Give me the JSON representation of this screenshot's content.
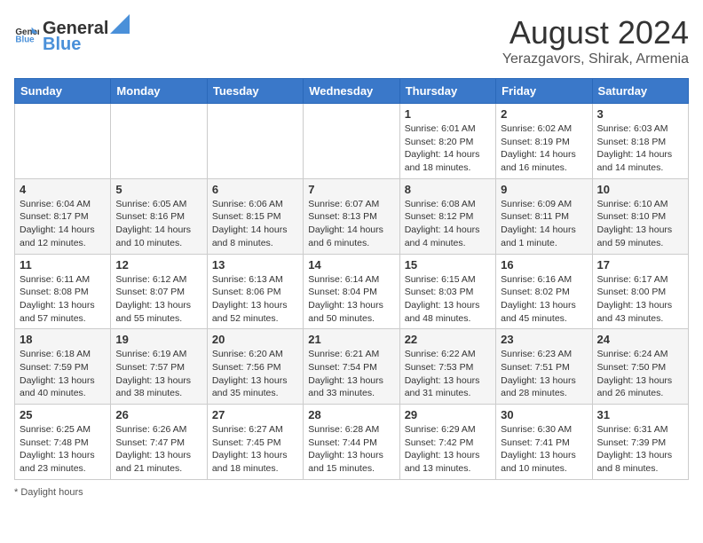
{
  "logo": {
    "general": "General",
    "blue": "Blue"
  },
  "title": "August 2024",
  "subtitle": "Yerazgavors, Shirak, Armenia",
  "days_header": [
    "Sunday",
    "Monday",
    "Tuesday",
    "Wednesday",
    "Thursday",
    "Friday",
    "Saturday"
  ],
  "weeks": [
    [
      {
        "day": "",
        "info": ""
      },
      {
        "day": "",
        "info": ""
      },
      {
        "day": "",
        "info": ""
      },
      {
        "day": "",
        "info": ""
      },
      {
        "day": "1",
        "info": "Sunrise: 6:01 AM\nSunset: 8:20 PM\nDaylight: 14 hours\nand 18 minutes."
      },
      {
        "day": "2",
        "info": "Sunrise: 6:02 AM\nSunset: 8:19 PM\nDaylight: 14 hours\nand 16 minutes."
      },
      {
        "day": "3",
        "info": "Sunrise: 6:03 AM\nSunset: 8:18 PM\nDaylight: 14 hours\nand 14 minutes."
      }
    ],
    [
      {
        "day": "4",
        "info": "Sunrise: 6:04 AM\nSunset: 8:17 PM\nDaylight: 14 hours\nand 12 minutes."
      },
      {
        "day": "5",
        "info": "Sunrise: 6:05 AM\nSunset: 8:16 PM\nDaylight: 14 hours\nand 10 minutes."
      },
      {
        "day": "6",
        "info": "Sunrise: 6:06 AM\nSunset: 8:15 PM\nDaylight: 14 hours\nand 8 minutes."
      },
      {
        "day": "7",
        "info": "Sunrise: 6:07 AM\nSunset: 8:13 PM\nDaylight: 14 hours\nand 6 minutes."
      },
      {
        "day": "8",
        "info": "Sunrise: 6:08 AM\nSunset: 8:12 PM\nDaylight: 14 hours\nand 4 minutes."
      },
      {
        "day": "9",
        "info": "Sunrise: 6:09 AM\nSunset: 8:11 PM\nDaylight: 14 hours\nand 1 minute."
      },
      {
        "day": "10",
        "info": "Sunrise: 6:10 AM\nSunset: 8:10 PM\nDaylight: 13 hours\nand 59 minutes."
      }
    ],
    [
      {
        "day": "11",
        "info": "Sunrise: 6:11 AM\nSunset: 8:08 PM\nDaylight: 13 hours\nand 57 minutes."
      },
      {
        "day": "12",
        "info": "Sunrise: 6:12 AM\nSunset: 8:07 PM\nDaylight: 13 hours\nand 55 minutes."
      },
      {
        "day": "13",
        "info": "Sunrise: 6:13 AM\nSunset: 8:06 PM\nDaylight: 13 hours\nand 52 minutes."
      },
      {
        "day": "14",
        "info": "Sunrise: 6:14 AM\nSunset: 8:04 PM\nDaylight: 13 hours\nand 50 minutes."
      },
      {
        "day": "15",
        "info": "Sunrise: 6:15 AM\nSunset: 8:03 PM\nDaylight: 13 hours\nand 48 minutes."
      },
      {
        "day": "16",
        "info": "Sunrise: 6:16 AM\nSunset: 8:02 PM\nDaylight: 13 hours\nand 45 minutes."
      },
      {
        "day": "17",
        "info": "Sunrise: 6:17 AM\nSunset: 8:00 PM\nDaylight: 13 hours\nand 43 minutes."
      }
    ],
    [
      {
        "day": "18",
        "info": "Sunrise: 6:18 AM\nSunset: 7:59 PM\nDaylight: 13 hours\nand 40 minutes."
      },
      {
        "day": "19",
        "info": "Sunrise: 6:19 AM\nSunset: 7:57 PM\nDaylight: 13 hours\nand 38 minutes."
      },
      {
        "day": "20",
        "info": "Sunrise: 6:20 AM\nSunset: 7:56 PM\nDaylight: 13 hours\nand 35 minutes."
      },
      {
        "day": "21",
        "info": "Sunrise: 6:21 AM\nSunset: 7:54 PM\nDaylight: 13 hours\nand 33 minutes."
      },
      {
        "day": "22",
        "info": "Sunrise: 6:22 AM\nSunset: 7:53 PM\nDaylight: 13 hours\nand 31 minutes."
      },
      {
        "day": "23",
        "info": "Sunrise: 6:23 AM\nSunset: 7:51 PM\nDaylight: 13 hours\nand 28 minutes."
      },
      {
        "day": "24",
        "info": "Sunrise: 6:24 AM\nSunset: 7:50 PM\nDaylight: 13 hours\nand 26 minutes."
      }
    ],
    [
      {
        "day": "25",
        "info": "Sunrise: 6:25 AM\nSunset: 7:48 PM\nDaylight: 13 hours\nand 23 minutes."
      },
      {
        "day": "26",
        "info": "Sunrise: 6:26 AM\nSunset: 7:47 PM\nDaylight: 13 hours\nand 21 minutes."
      },
      {
        "day": "27",
        "info": "Sunrise: 6:27 AM\nSunset: 7:45 PM\nDaylight: 13 hours\nand 18 minutes."
      },
      {
        "day": "28",
        "info": "Sunrise: 6:28 AM\nSunset: 7:44 PM\nDaylight: 13 hours\nand 15 minutes."
      },
      {
        "day": "29",
        "info": "Sunrise: 6:29 AM\nSunset: 7:42 PM\nDaylight: 13 hours\nand 13 minutes."
      },
      {
        "day": "30",
        "info": "Sunrise: 6:30 AM\nSunset: 7:41 PM\nDaylight: 13 hours\nand 10 minutes."
      },
      {
        "day": "31",
        "info": "Sunrise: 6:31 AM\nSunset: 7:39 PM\nDaylight: 13 hours\nand 8 minutes."
      }
    ]
  ],
  "footer": "Daylight hours"
}
